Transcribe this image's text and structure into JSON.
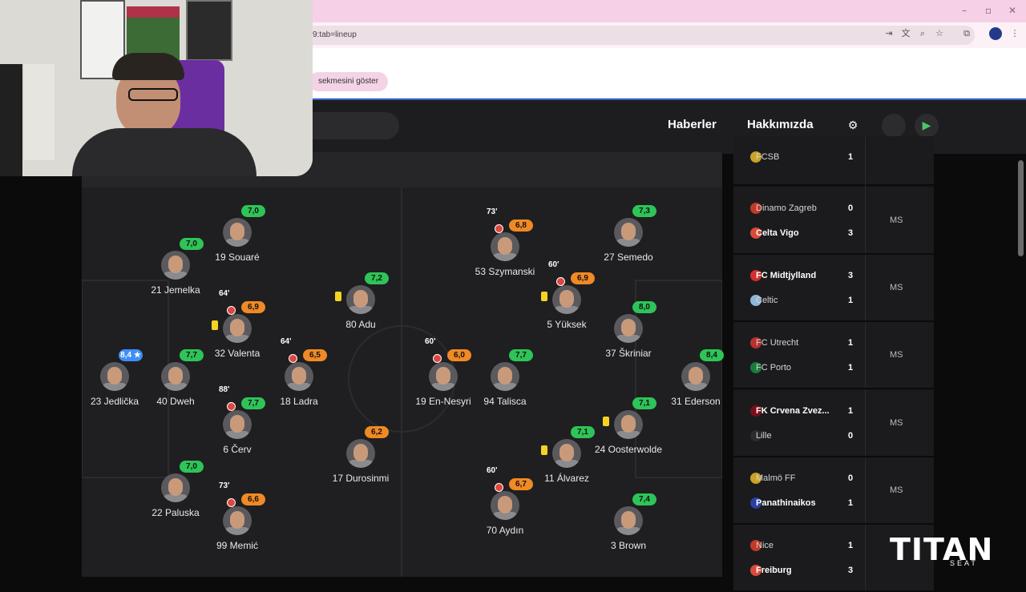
{
  "browser": {
    "url": "9:tab=lineup",
    "bookmark_chip": "sekmesini göster",
    "window_controls": [
      "–",
      "▫",
      "✕"
    ]
  },
  "site": {
    "nav": [
      "Haberler",
      "Hakkımızda"
    ],
    "icons": [
      "gear-icon",
      "apple-icon",
      "google-play-icon"
    ]
  },
  "lineup": [
    {
      "id": "jedlicka",
      "name": "23 Jedlička",
      "rating": "8,4 ★",
      "color": "blue"
    },
    {
      "id": "jemelka",
      "name": "21 Jemelka",
      "rating": "7,0",
      "color": "green"
    },
    {
      "id": "dweh",
      "name": "40 Dweh",
      "rating": "7,7",
      "color": "green"
    },
    {
      "id": "paluska",
      "name": "22 Paluska",
      "rating": "7,0",
      "color": "green"
    },
    {
      "id": "souare",
      "name": "19 Souaré",
      "rating": "7,0",
      "color": "green"
    },
    {
      "id": "valenta",
      "name": "32 Valenta",
      "rating": "6,9",
      "color": "orange",
      "sub": "64'",
      "yellow": true
    },
    {
      "id": "cerv",
      "name": "6 Červ",
      "rating": "7,7",
      "color": "green",
      "sub": "88'"
    },
    {
      "id": "memic",
      "name": "99 Memić",
      "rating": "6,6",
      "color": "orange",
      "sub": "73'"
    },
    {
      "id": "ladra",
      "name": "18 Ladra",
      "rating": "6,5",
      "color": "orange",
      "sub": "64'"
    },
    {
      "id": "adu",
      "name": "80 Adu",
      "rating": "7,2",
      "color": "green",
      "yellow": true
    },
    {
      "id": "durosinmi",
      "name": "17 Durosinmi",
      "rating": "6,2",
      "color": "orange"
    },
    {
      "id": "ennesyri",
      "name": "19 En-Nesyri",
      "rating": "6,0",
      "color": "orange",
      "sub": "60'"
    },
    {
      "id": "szymanski",
      "name": "53 Szymanski",
      "rating": "6,8",
      "color": "orange",
      "sub": "73'"
    },
    {
      "id": "talisca",
      "name": "94 Talisca",
      "rating": "7,7",
      "color": "green"
    },
    {
      "id": "aydin",
      "name": "70 Aydın",
      "rating": "6,7",
      "color": "orange",
      "sub": "60'"
    },
    {
      "id": "yuksek",
      "name": "5 Yüksek",
      "rating": "6,9",
      "color": "orange",
      "sub": "60'",
      "yellow": true
    },
    {
      "id": "alvarez",
      "name": "11 Álvarez",
      "rating": "7,1",
      "color": "green",
      "yellow": true
    },
    {
      "id": "semedo",
      "name": "27 Semedo",
      "rating": "7,3",
      "color": "green"
    },
    {
      "id": "skriniar",
      "name": "37 Škriniar",
      "rating": "8,0",
      "color": "green"
    },
    {
      "id": "oosterwolde",
      "name": "24 Oosterwolde",
      "rating": "7,1",
      "color": "green",
      "yellow": true
    },
    {
      "id": "brown",
      "name": "3 Brown",
      "rating": "7,4",
      "color": "green"
    },
    {
      "id": "ederson",
      "name": "31 Ederson",
      "rating": "8,4",
      "color": "green"
    }
  ],
  "matches": [
    {
      "home": "FCSB",
      "home_score": "1",
      "away": "",
      "away_score": "",
      "status": ""
    },
    {
      "home": "Dinamo Zagreb",
      "home_score": "0",
      "away": "Celta Vigo",
      "away_score": "3",
      "status": "MS",
      "winner": "away"
    },
    {
      "home": "FC Midtjylland",
      "home_score": "3",
      "away": "Celtic",
      "away_score": "1",
      "status": "MS",
      "winner": "home"
    },
    {
      "home": "FC Utrecht",
      "home_score": "1",
      "away": "FC Porto",
      "away_score": "1",
      "status": "MS",
      "winner": ""
    },
    {
      "home": "FK Crvena Zvez...",
      "home_score": "1",
      "away": "Lille",
      "away_score": "0",
      "status": "MS",
      "winner": "home"
    },
    {
      "home": "Malmö FF",
      "home_score": "0",
      "away": "Panathinaikos",
      "away_score": "1",
      "status": "MS",
      "winner": "away"
    },
    {
      "home": "Nice",
      "home_score": "1",
      "away": "Freiburg",
      "away_score": "3",
      "status": "",
      "winner": "away"
    }
  ],
  "watermark": {
    "title": "TITAN",
    "subtitle": "SEAT"
  }
}
